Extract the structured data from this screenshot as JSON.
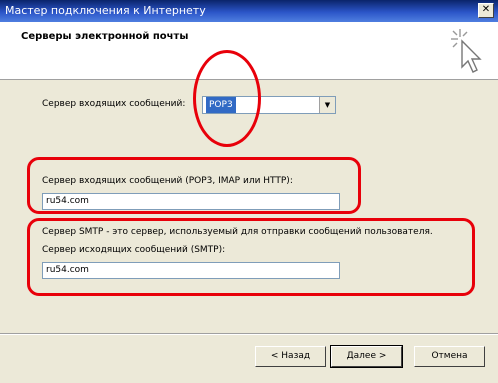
{
  "window": {
    "title": "Мастер подключения к Интернету",
    "close_label": "✕"
  },
  "header": {
    "heading": "Серверы электронной почты"
  },
  "incoming_type": {
    "label": "Сервер входящих сообщений:",
    "selected": "POP3",
    "arrow": "▼"
  },
  "incoming_server": {
    "label": "Сервер входящих сообщений (POP3, IMAP или HTTP):",
    "value": "ru54.com"
  },
  "smtp": {
    "description": "Сервер SMTP - это сервер, используемый для отправки сообщений  пользователя.",
    "label": "Сервер исходящих сообщений (SMTP):",
    "value": "ru54.com"
  },
  "buttons": {
    "back": "< Назад",
    "next": "Далее >",
    "cancel": "Отмена"
  },
  "colors": {
    "highlight": "#e8000a",
    "titlebar": "#0a246a",
    "face": "#ece9d8"
  }
}
